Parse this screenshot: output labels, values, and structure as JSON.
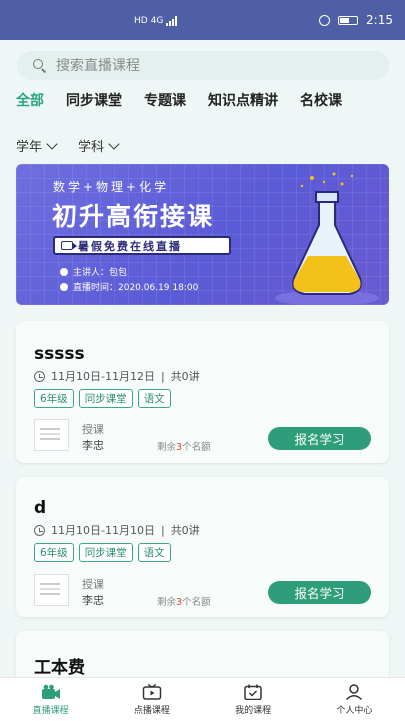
{
  "status_bar": {
    "network_labels": [
      "HD",
      "4G"
    ],
    "time": "2:15"
  },
  "search": {
    "placeholder": "搜索直播课程"
  },
  "tabs": [
    {
      "label": "全部",
      "active": true
    },
    {
      "label": "同步课堂"
    },
    {
      "label": "专题课"
    },
    {
      "label": "知识点精讲"
    },
    {
      "label": "名校课"
    }
  ],
  "filters": [
    {
      "label": "学年"
    },
    {
      "label": "学科"
    }
  ],
  "banner": {
    "subtitle": "数学+物理+化学",
    "title": "初升高衔接课",
    "pill": "暑假免费在线直播",
    "speaker": "主讲人：包包",
    "time": "直播时间：2020.06.19 18:00"
  },
  "courses": [
    {
      "title": "sssss",
      "date_range": "11月10日-11月12日",
      "separator": "|",
      "lessons": "共0讲",
      "tags": [
        "6年级",
        "同步课堂",
        "语文"
      ],
      "teacher_label": "授课",
      "teacher_name": "李忠",
      "seats_prefix": "剩余",
      "seats_count": "3",
      "seats_suffix": "个名额",
      "button": "报名学习"
    },
    {
      "title": "d",
      "date_range": "11月10日-11月10日",
      "separator": "|",
      "lessons": "共0讲",
      "tags": [
        "6年级",
        "同步课堂",
        "语文"
      ],
      "teacher_label": "授课",
      "teacher_name": "李忠",
      "seats_prefix": "剩余",
      "seats_count": "3",
      "seats_suffix": "个名额",
      "button": "报名学习"
    },
    {
      "title": "工本费"
    }
  ],
  "bottom_nav": [
    {
      "label": "直播课程",
      "icon": "live-camera-icon",
      "active": true
    },
    {
      "label": "点播课程",
      "icon": "tv-play-icon"
    },
    {
      "label": "我的课程",
      "icon": "calendar-check-icon"
    },
    {
      "label": "个人中心",
      "icon": "user-icon"
    }
  ],
  "colors": {
    "accent": "#2e9e7a",
    "status_bar": "#4f5fa5",
    "banner": "#5a5bd6"
  }
}
